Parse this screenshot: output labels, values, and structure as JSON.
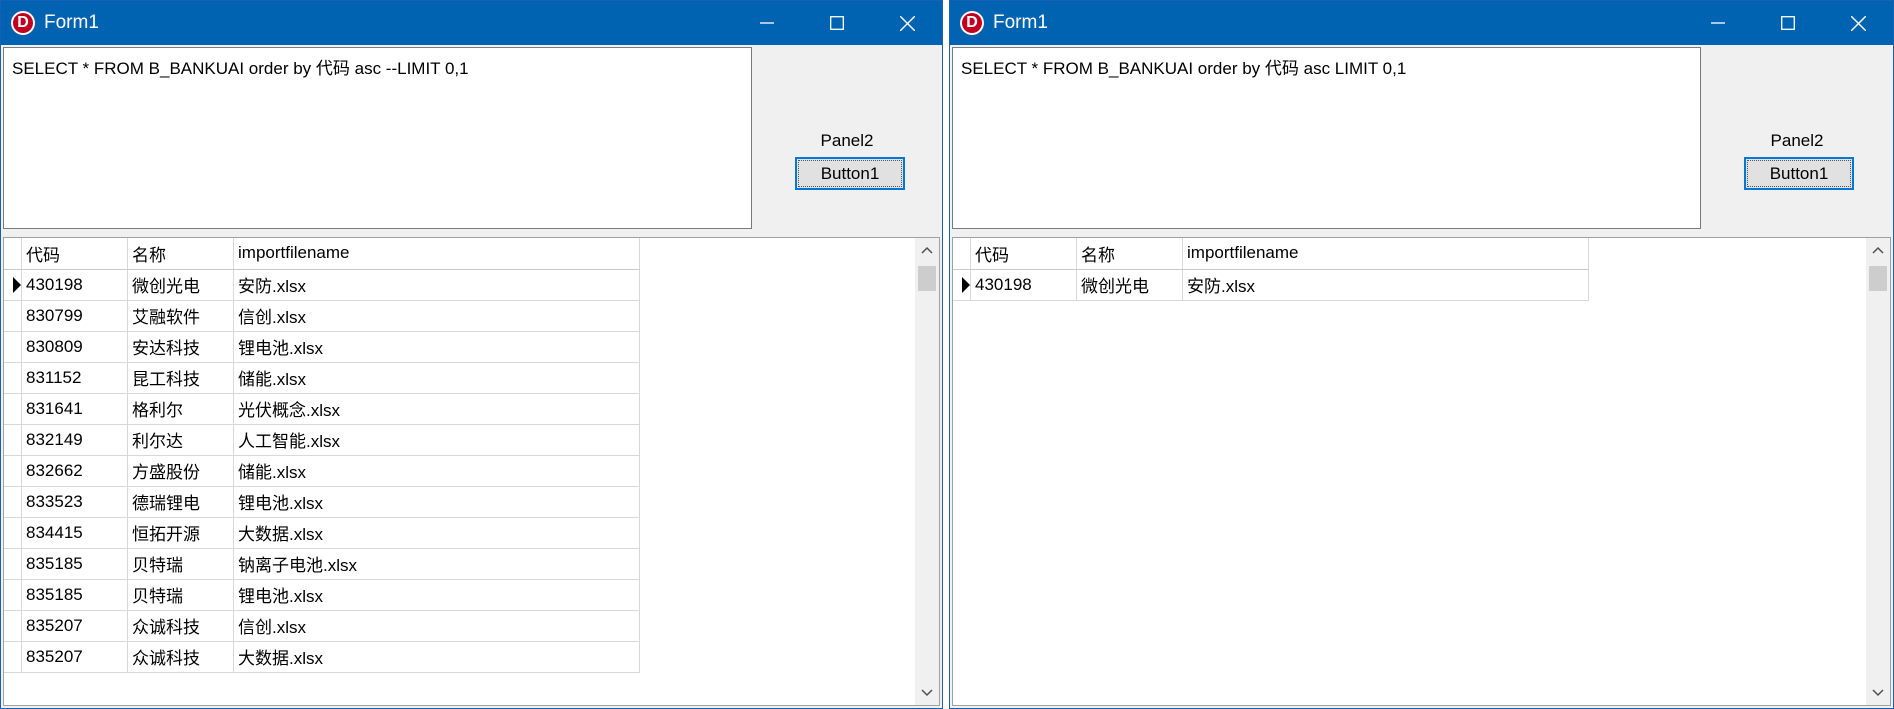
{
  "windows": [
    {
      "title": "Form1",
      "app_icon_letter": "D",
      "sql_text": "SELECT * FROM B_BANKUAI order by 代码 asc --LIMIT 0,1",
      "panel_caption": "Panel2",
      "button_label": "Button1",
      "grid": {
        "headers": [
          "代码",
          "名称",
          "importfilename"
        ],
        "rows": [
          {
            "code": "430198",
            "name": "微创光电",
            "file": "安防.xlsx"
          },
          {
            "code": "830799",
            "name": "艾融软件",
            "file": "信创.xlsx"
          },
          {
            "code": "830809",
            "name": "安达科技",
            "file": "锂电池.xlsx"
          },
          {
            "code": "831152",
            "name": "昆工科技",
            "file": "储能.xlsx"
          },
          {
            "code": "831641",
            "name": "格利尔",
            "file": "光伏概念.xlsx"
          },
          {
            "code": "832149",
            "name": "利尔达",
            "file": "人工智能.xlsx"
          },
          {
            "code": "832662",
            "name": "方盛股份",
            "file": "储能.xlsx"
          },
          {
            "code": "833523",
            "name": "德瑞锂电",
            "file": "锂电池.xlsx"
          },
          {
            "code": "834415",
            "name": "恒拓开源",
            "file": "大数据.xlsx"
          },
          {
            "code": "835185",
            "name": "贝特瑞",
            "file": "钠离子电池.xlsx"
          },
          {
            "code": "835185",
            "name": "贝特瑞",
            "file": "锂电池.xlsx"
          },
          {
            "code": "835207",
            "name": "众诚科技",
            "file": "信创.xlsx"
          },
          {
            "code": "835207",
            "name": "众诚科技",
            "file": "大数据.xlsx"
          }
        ]
      }
    },
    {
      "title": "Form1",
      "app_icon_letter": "D",
      "sql_text": "SELECT * FROM B_BANKUAI order by 代码 asc LIMIT 0,1",
      "panel_caption": "Panel2",
      "button_label": "Button1",
      "grid": {
        "headers": [
          "代码",
          "名称",
          "importfilename"
        ],
        "rows": [
          {
            "code": "430198",
            "name": "微创光电",
            "file": "安防.xlsx"
          }
        ]
      }
    }
  ],
  "icons": {
    "minimize": "minimize-icon",
    "maximize": "maximize-icon",
    "close": "close-icon",
    "scroll_up": "chevron-up-icon",
    "scroll_down": "chevron-down-icon",
    "row_indicator": "row-pointer-icon"
  },
  "colors": {
    "titlebar": "#0063b1",
    "app_icon": "#c00020",
    "button_focus_border": "#0078d7"
  }
}
